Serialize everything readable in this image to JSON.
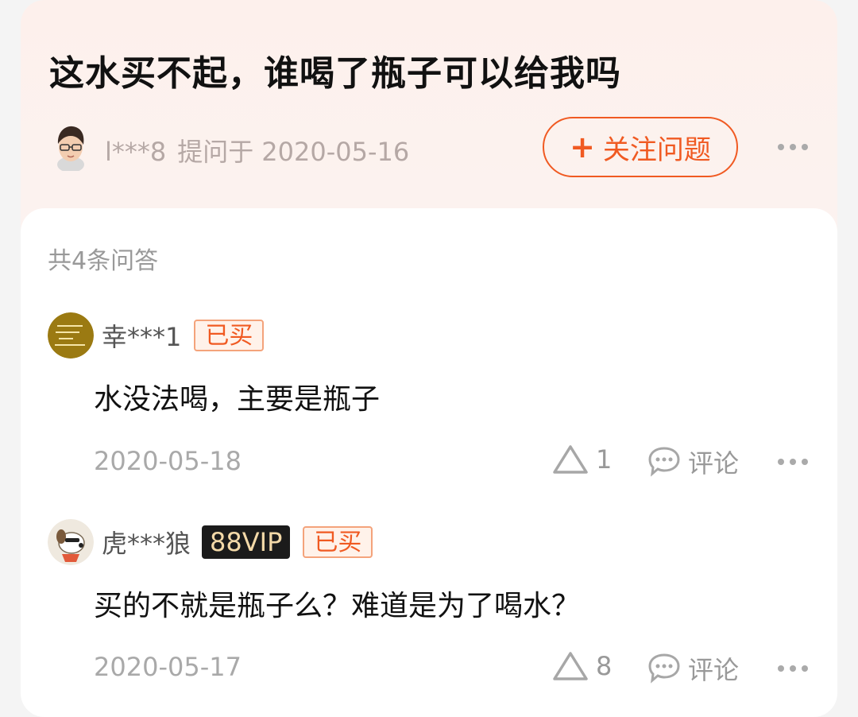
{
  "question": {
    "title": "这水买不起，谁喝了瓶子可以给我吗",
    "asker_name": "l***8",
    "asked_label": "提问于",
    "asked_date": "2020-05-16",
    "follow_label": "关注问题",
    "follow_icon": "plus-icon"
  },
  "answers_count_label": "共4条问答",
  "answers": [
    {
      "user": "幸***1",
      "badges": [
        "已买"
      ],
      "text": "水没法喝，主要是瓶子",
      "date": "2020-05-18",
      "likes": "1",
      "comment_label": "评论"
    },
    {
      "user": "虎***狼",
      "vip_badge": "88VIP",
      "badges": [
        "已买"
      ],
      "text": "买的不就是瓶子么？难道是为了喝水？",
      "date": "2020-05-17",
      "likes": "8",
      "comment_label": "评论"
    }
  ],
  "colors": {
    "accent": "#f05a22",
    "header_bg": "#fdf0ec",
    "muted_text": "#a9a9a9",
    "vip_bg": "#1b1b1b"
  }
}
